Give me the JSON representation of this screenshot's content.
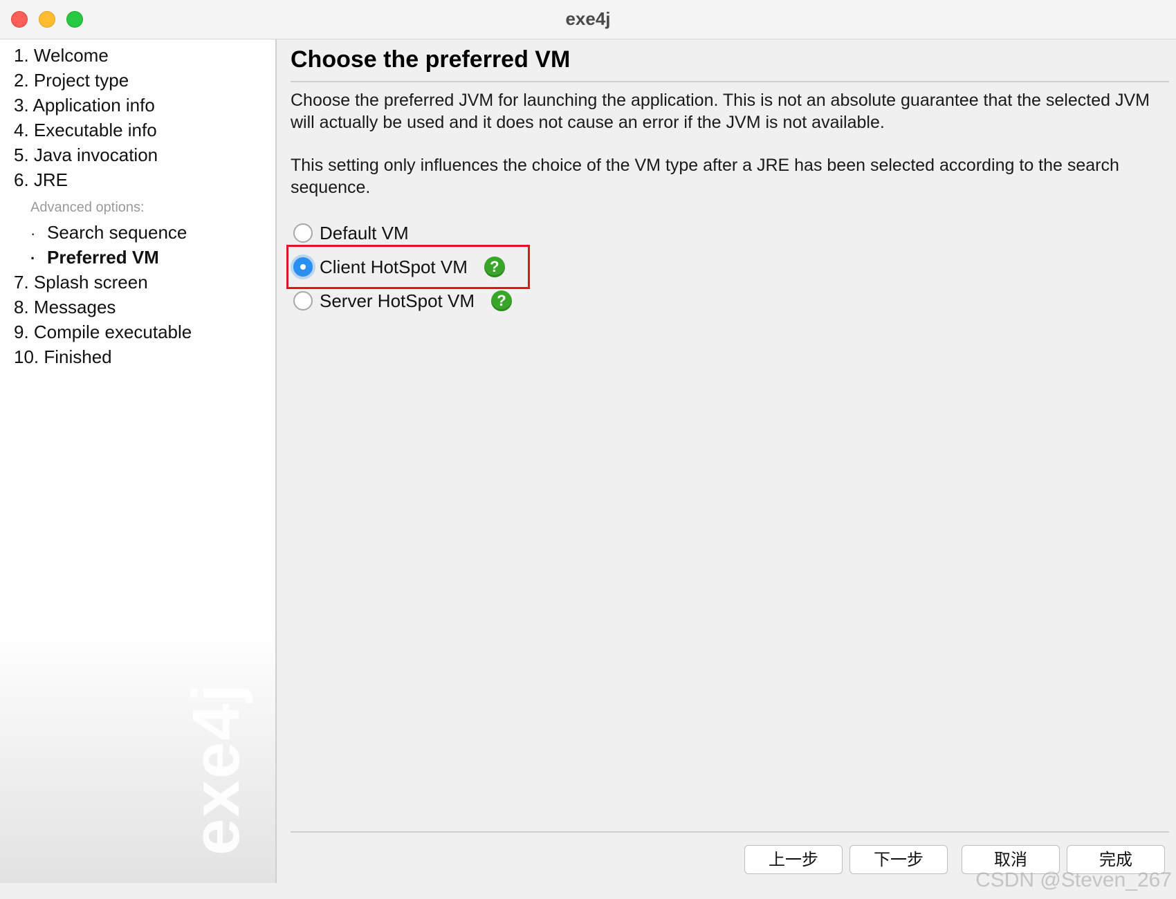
{
  "window": {
    "title": "exe4j"
  },
  "sidebar": {
    "items": [
      {
        "label": "1. Welcome"
      },
      {
        "label": "2. Project type"
      },
      {
        "label": "3. Application info"
      },
      {
        "label": "4. Executable info"
      },
      {
        "label": "5. Java invocation"
      },
      {
        "label": "6. JRE"
      }
    ],
    "advanced_label": "Advanced options:",
    "sub_items": [
      {
        "label": "Search sequence",
        "active": false
      },
      {
        "label": "Preferred VM",
        "active": true
      }
    ],
    "items_after": [
      {
        "label": "7. Splash screen"
      },
      {
        "label": "8. Messages"
      },
      {
        "label": "9. Compile executable"
      },
      {
        "label": "10. Finished"
      }
    ],
    "logo_text": "exe4j"
  },
  "main": {
    "heading": "Choose the preferred VM",
    "paragraph1": "Choose the preferred JVM for launching the application. This is not an absolute guarantee that the selected JVM will actually be used and it does not cause an error if the JVM is not available.",
    "paragraph2": "This setting only influences the choice of the VM type after a JRE has been selected according to the search sequence.",
    "options": [
      {
        "label": "Default VM",
        "checked": false,
        "help": false
      },
      {
        "label": "Client HotSpot VM",
        "checked": true,
        "help": true
      },
      {
        "label": "Server HotSpot VM",
        "checked": false,
        "help": true
      }
    ],
    "help_glyph": "?",
    "highlight_color": "#e0141e"
  },
  "buttons": {
    "back": "上一步",
    "next": "下一步",
    "cancel": "取消",
    "finish": "完成"
  },
  "watermark": "CSDN @Steven_267",
  "colors": {
    "radio_selected": "#2a8ff0",
    "help_icon": "#3aa629"
  }
}
